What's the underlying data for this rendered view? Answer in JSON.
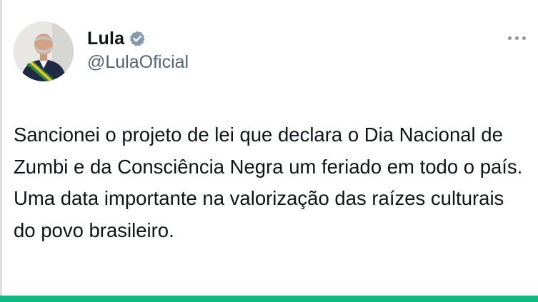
{
  "author": {
    "display_name": "Lula",
    "handle": "@LulaOficial",
    "verified": true,
    "verified_icon": "verified-badge-icon",
    "avatar_icon": "profile-photo"
  },
  "menu": {
    "more_icon": "more-horizontal-icon"
  },
  "tweet": {
    "text": "Sancionei o projeto de lei que declara o Dia Nacional de Zumbi e da Consciência Negra um feriado em todo o país. Uma data importante na valorização das raízes culturais do povo brasileiro."
  },
  "colors": {
    "name": "#0f1419",
    "handle": "#536471",
    "badge": "#829aab",
    "bottom_bar": "#10b981",
    "background": "#ffffff"
  }
}
